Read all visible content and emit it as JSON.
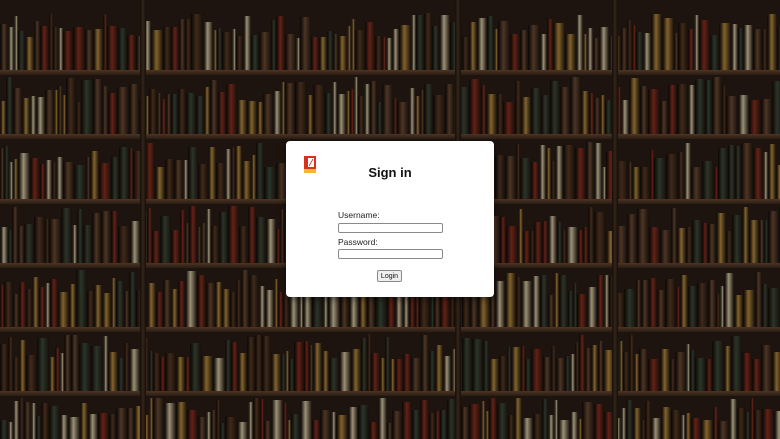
{
  "login": {
    "title": "Sign in",
    "username_label": "Username:",
    "username_value": "",
    "password_label": "Password:",
    "password_value": "",
    "submit_label": "Login"
  },
  "logo": {
    "icon": "book-logo-icon",
    "colors": [
      "#d9321c",
      "#f2b632",
      "#ffffff"
    ]
  },
  "background": {
    "description_icon": "bookshelf-background",
    "palette": [
      "#2a1d15",
      "#6b4a33",
      "#8b2e1f",
      "#b5893d",
      "#d8c9a3",
      "#3c4a3a",
      "#5a3a24"
    ]
  }
}
